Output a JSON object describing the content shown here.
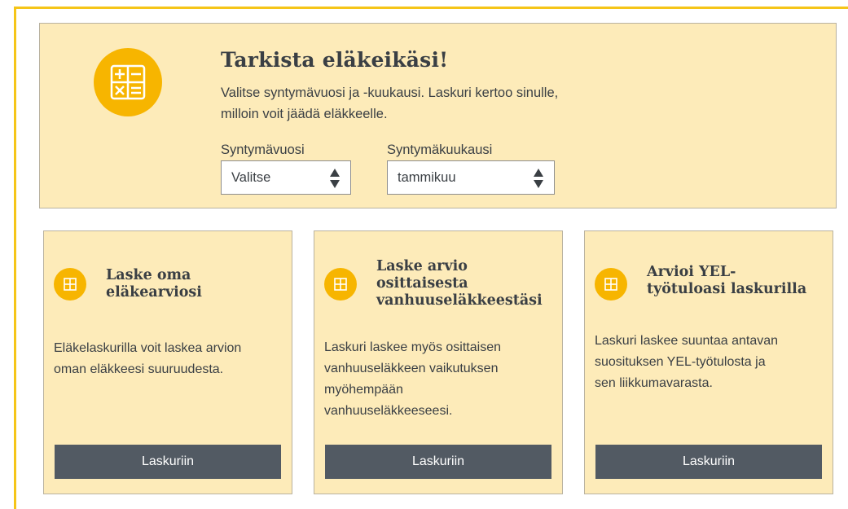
{
  "hero": {
    "title": "Tarkista eläkeikäsi!",
    "description": "Valitse syntymävuosi ja -kuukausi. Laskuri kertoo sinulle, milloin voit jäädä eläkkeelle.",
    "icon": "calculator-icon",
    "birth_year": {
      "label": "Syntymävuosi",
      "value": "Valitse"
    },
    "birth_month": {
      "label": "Syntymäkuukausi",
      "value": "tammikuu"
    }
  },
  "cards": [
    {
      "icon": "calculator-icon",
      "title_lines": [
        "Laske oma",
        "eläkearviosi"
      ],
      "text_lines": [
        "Eläkelaskurilla voit laskea arvion",
        "oman eläkkeesi suuruudesta."
      ],
      "button": "Laskuriin"
    },
    {
      "icon": "calculator-icon",
      "title_lines": [
        "Laske arvio",
        "osittaisesta",
        "vanhuuseläkkeestäsi"
      ],
      "text_lines": [
        "Laskuri laskee myös osittaisen",
        "vanhuuseläkkeen vaikutuksen",
        "myöhempään",
        "vanhuuseläkkeeseesi."
      ],
      "button": "Laskuriin"
    },
    {
      "icon": "calculator-icon",
      "title_lines": [
        "Arvioi YEL-",
        "työtuloasi laskurilla"
      ],
      "text_lines": [
        "Laskuri laskee suuntaa antavan",
        "suosituksen YEL-työtulosta ja",
        "sen liikkumavarasta."
      ],
      "button": "Laskuriin"
    }
  ],
  "colors": {
    "accent": "#f7b500",
    "card_bg": "#fdebb9",
    "button_bg": "#525a63",
    "frame": "#f5c518"
  }
}
